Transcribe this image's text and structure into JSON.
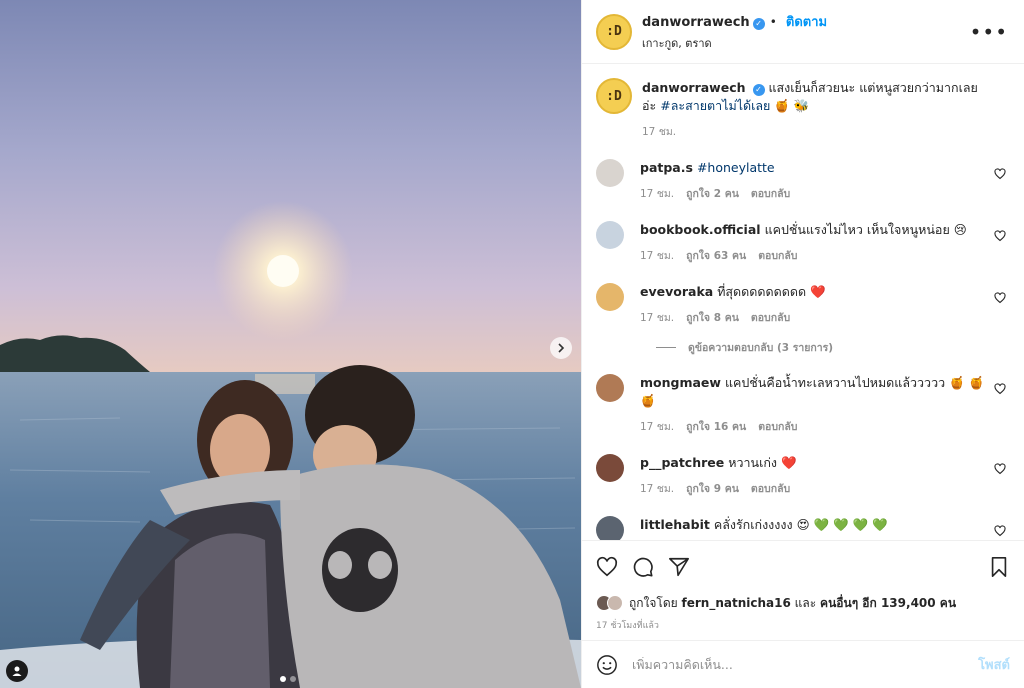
{
  "post": {
    "username": "danworrawech",
    "follow_label": "ติดตาม",
    "location": "เกาะกูด, ตราด",
    "more_label": "•••",
    "avatar_text": ":D",
    "caption_text": "แสงเย็นก็สวยนะ แต่หนูสวยกว่ามากเลยอ่ะ",
    "caption_hashtag": "#ละสายตาไม่ได้เลย",
    "caption_emoji": "🍯 🐝",
    "caption_time": "17 ชม.",
    "likes_prefix": "ถูกใจโดย",
    "likes_user": "fern_natnicha16",
    "likes_and": "และ",
    "likes_others": "คนอื่นๆ อีก 139,400 คน",
    "time_ago": "17 ชั่วโมงที่แล้ว",
    "comment_placeholder": "เพิ่มความคิดเห็น...",
    "post_button": "โพสต์",
    "carousel": {
      "count": 2,
      "active": 1
    }
  },
  "comments": [
    {
      "user": "patpa.s",
      "text": "",
      "hashtag": "#honeylatte",
      "time": "17 ชม.",
      "likes": "ถูกใจ 2 คน",
      "reply": "ตอบกลับ",
      "avatar_color": "#d9d4cf"
    },
    {
      "user": "bookbook.official",
      "text": "แคปชั่นแรงไม่ไหว เห็นใจหนูหน่อย 😢",
      "hashtag": "",
      "time": "17 ชม.",
      "likes": "ถูกใจ 63 คน",
      "reply": "ตอบกลับ",
      "avatar_color": "#c8d3df"
    },
    {
      "user": "evevoraka",
      "text": "ที่สุดดดดดดดดด ❤️",
      "hashtag": "",
      "time": "17 ชม.",
      "likes": "ถูกใจ 8 คน",
      "reply": "ตอบกลับ",
      "avatar_color": "#e5b66a",
      "view_replies": "ดูข้อความตอบกลับ (3 รายการ)"
    },
    {
      "user": "mongmaew",
      "text": "แคปชั่นคือน้ำทะเลหวานไปหมดแล้ววววว 🍯 🍯 🍯",
      "hashtag": "",
      "time": "17 ชม.",
      "likes": "ถูกใจ 16 คน",
      "reply": "ตอบกลับ",
      "avatar_color": "#b07a55"
    },
    {
      "user": "p__patchree",
      "text": "หวานเก่ง ❤️",
      "hashtag": "",
      "time": "17 ชม.",
      "likes": "ถูกใจ 9 คน",
      "reply": "ตอบกลับ",
      "avatar_color": "#7a4a3a"
    },
    {
      "user": "littlehabit",
      "text": "คลั่งรักเก่งงงงง 😍 💚 💚 💚 💚",
      "hashtag": "",
      "time": "",
      "likes": "",
      "reply": "",
      "avatar_color": "#5b6470"
    }
  ],
  "colors": {
    "link": "#0095f6",
    "hashtag": "#00376b",
    "muted": "#8e8e8e",
    "text": "#262626"
  },
  "icons": [
    "chevron-right-icon",
    "heart-icon",
    "comment-icon",
    "share-icon",
    "bookmark-icon",
    "emoji-icon",
    "verified-icon",
    "more-icon",
    "user-tag-icon"
  ]
}
